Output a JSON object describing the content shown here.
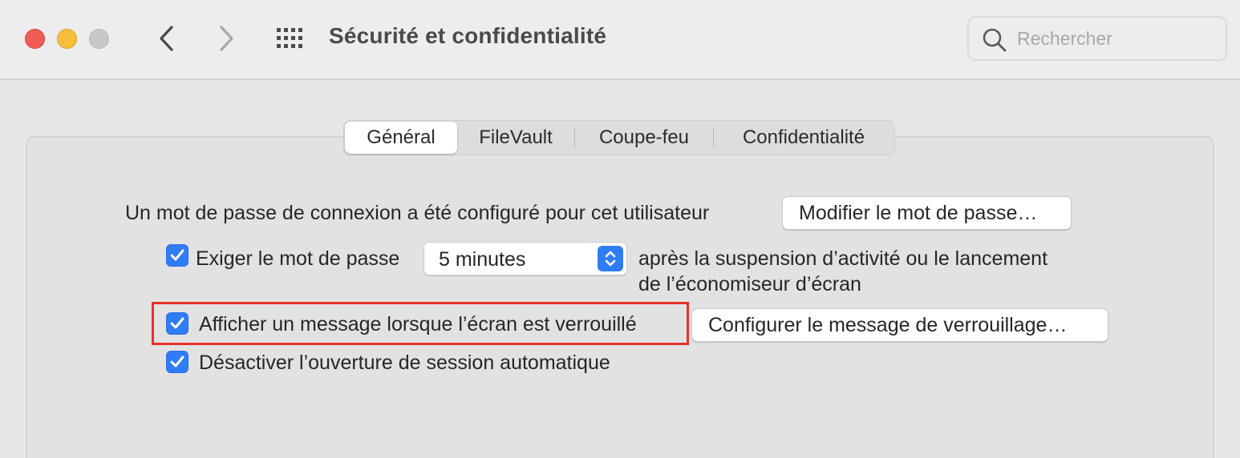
{
  "window": {
    "title": "Sécurité et confidentialité"
  },
  "toolbar": {
    "back_icon": "chevron-left-icon",
    "forward_icon": "chevron-right-icon",
    "grid_icon": "grid-dots-icon"
  },
  "search": {
    "placeholder": "Rechercher",
    "icon": "search-icon"
  },
  "tabs": [
    {
      "label": "Général",
      "active": true
    },
    {
      "label": "FileVault",
      "active": false
    },
    {
      "label": "Coupe-feu",
      "active": false
    },
    {
      "label": "Confidentialité",
      "active": false
    }
  ],
  "general": {
    "password_text": "Un mot de passe de connexion a été configuré pour cet utilisateur",
    "change_password_button": "Modifier le mot de passe…",
    "require_password": {
      "checked": true,
      "label": "Exiger le mot de passe",
      "delay_value": "5 minutes",
      "after_text_line1": "après la suspension d’activité ou le lancement",
      "after_text_line2": "de l’économiseur d’écran"
    },
    "show_message": {
      "checked": true,
      "label": "Afficher un message lorsque l’écran est verrouillé",
      "button": "Configurer le message de verrouillage…"
    },
    "disable_auto_login": {
      "checked": true,
      "label": "Désactiver l’ouverture de session automatique"
    }
  },
  "colors": {
    "accent": "#2f7cf6",
    "highlight": "#e8302a",
    "close": "#ee5c55",
    "minimize": "#f6be3a",
    "zoom_inactive": "#c9c8c9"
  }
}
